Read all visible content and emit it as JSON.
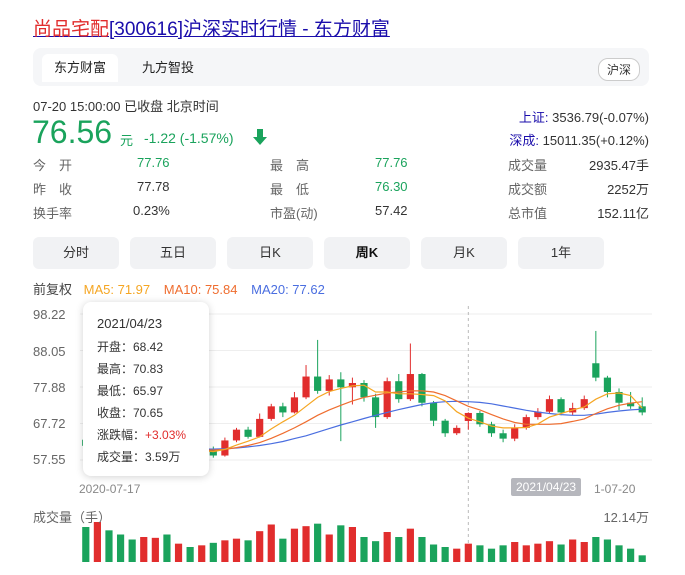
{
  "header": {
    "title_highlight": "尚品宅配",
    "title_rest": "[300616]沪深实时行情 - 东方财富"
  },
  "tabs": [
    {
      "label": "东方财富",
      "active": true
    },
    {
      "label": "九方智投",
      "active": false
    }
  ],
  "market_badge": "沪深",
  "quote": {
    "time_status": "07-20 15:00:00  已收盘  北京时间",
    "price": "76.56",
    "unit": "元",
    "change": "-1.22 (-1.57%)",
    "direction": "down"
  },
  "indices": [
    {
      "name": "上证:",
      "value": "3536.79(-0.07%)"
    },
    {
      "name": "深成:",
      "value": "15011.35(+0.12%)"
    }
  ],
  "stats": {
    "open": {
      "label": "今　开",
      "value": "77.76"
    },
    "high": {
      "label": "最　高",
      "value": "77.76"
    },
    "volume": {
      "label": "成交量",
      "value": "2935.47手"
    },
    "prev_close": {
      "label": "昨　收",
      "value": "77.78"
    },
    "low": {
      "label": "最　低",
      "value": "76.30"
    },
    "amount": {
      "label": "成交额",
      "value": "2252万"
    },
    "turnover": {
      "label": "换手率",
      "value": "0.23%"
    },
    "pe": {
      "label": "市盈(动)",
      "value": "57.42"
    },
    "mcap": {
      "label": "总市值",
      "value": "152.11亿"
    }
  },
  "periods": [
    {
      "label": "分时",
      "active": false
    },
    {
      "label": "五日",
      "active": false
    },
    {
      "label": "日K",
      "active": false
    },
    {
      "label": "周K",
      "active": true
    },
    {
      "label": "月K",
      "active": false
    },
    {
      "label": "1年",
      "active": false
    }
  ],
  "ma_legend": {
    "adj": "前复权",
    "ma5": "MA5: 71.97",
    "ma10": "MA10: 75.84",
    "ma20": "MA20: 77.62"
  },
  "colors": {
    "up": "#e12d2d",
    "down": "#1aa35c",
    "ma5": "#f5a623",
    "ma10": "#ef6d2f",
    "ma20": "#4a6ee0"
  },
  "y_axis_labels": [
    "98.22",
    "88.05",
    "77.88",
    "67.72",
    "57.55"
  ],
  "x_axis": {
    "start": "2020-07-17",
    "hover": "2021/04/23",
    "end_partial": "1-07-20"
  },
  "tooltip": {
    "date": "2021/04/23",
    "open": "开盘：68.42",
    "high": "最高：70.83",
    "low": "最低：65.97",
    "close": "收盘：70.65",
    "change_label": "涨跌幅：",
    "change_value": "+3.03%",
    "volume": "成交量：3.59万"
  },
  "volume_panel": {
    "label": "成交量（手）",
    "max": "12.14万"
  },
  "chart_data": {
    "type": "candlestick",
    "ylim": [
      57.55,
      98.22
    ],
    "candles": [
      {
        "o": 63.2,
        "c": 61.5,
        "h": 64.0,
        "l": 60.8
      },
      {
        "o": 61.6,
        "c": 62.8,
        "h": 63.5,
        "l": 60.9
      },
      {
        "o": 62.8,
        "c": 61.0,
        "h": 63.2,
        "l": 59.8
      },
      {
        "o": 61.0,
        "c": 60.2,
        "h": 61.8,
        "l": 59.2
      },
      {
        "o": 60.2,
        "c": 58.8,
        "h": 61.2,
        "l": 58.0
      },
      {
        "o": 58.8,
        "c": 59.9,
        "h": 60.5,
        "l": 58.0
      },
      {
        "o": 59.9,
        "c": 61.3,
        "h": 62.5,
        "l": 59.4
      },
      {
        "o": 61.3,
        "c": 59.8,
        "h": 62.0,
        "l": 59.0
      },
      {
        "o": 59.8,
        "c": 60.8,
        "h": 61.8,
        "l": 59.0
      },
      {
        "o": 60.8,
        "c": 59.4,
        "h": 61.2,
        "l": 58.8
      },
      {
        "o": 59.4,
        "c": 60.6,
        "h": 61.2,
        "l": 58.6
      },
      {
        "o": 60.6,
        "c": 58.8,
        "h": 61.3,
        "l": 58.2
      },
      {
        "o": 58.8,
        "c": 63.0,
        "h": 63.8,
        "l": 58.5
      },
      {
        "o": 63.0,
        "c": 66.0,
        "h": 66.5,
        "l": 62.5
      },
      {
        "o": 66.0,
        "c": 64.0,
        "h": 66.8,
        "l": 63.5
      },
      {
        "o": 64.0,
        "c": 69.0,
        "h": 70.5,
        "l": 63.8
      },
      {
        "o": 69.0,
        "c": 72.5,
        "h": 73.2,
        "l": 68.5
      },
      {
        "o": 72.5,
        "c": 70.8,
        "h": 73.5,
        "l": 69.5
      },
      {
        "o": 70.8,
        "c": 75.0,
        "h": 76.5,
        "l": 70.5
      },
      {
        "o": 75.0,
        "c": 80.8,
        "h": 84.0,
        "l": 74.5
      },
      {
        "o": 80.8,
        "c": 76.8,
        "h": 91.0,
        "l": 76.0
      },
      {
        "o": 76.8,
        "c": 80.0,
        "h": 81.2,
        "l": 75.5
      },
      {
        "o": 80.0,
        "c": 77.8,
        "h": 82.0,
        "l": 62.8
      },
      {
        "o": 77.8,
        "c": 79.0,
        "h": 80.5,
        "l": 73.0
      },
      {
        "o": 79.0,
        "c": 75.0,
        "h": 79.8,
        "l": 73.8
      },
      {
        "o": 75.0,
        "c": 69.5,
        "h": 76.0,
        "l": 66.5
      },
      {
        "o": 69.5,
        "c": 79.5,
        "h": 80.5,
        "l": 69.0
      },
      {
        "o": 79.5,
        "c": 74.5,
        "h": 81.5,
        "l": 73.5
      },
      {
        "o": 74.5,
        "c": 81.5,
        "h": 90.0,
        "l": 74.0
      },
      {
        "o": 81.5,
        "c": 73.5,
        "h": 81.8,
        "l": 72.5
      },
      {
        "o": 73.5,
        "c": 68.5,
        "h": 74.0,
        "l": 67.0
      },
      {
        "o": 68.5,
        "c": 65.0,
        "h": 69.0,
        "l": 64.0
      },
      {
        "o": 65.0,
        "c": 66.5,
        "h": 67.2,
        "l": 64.5
      },
      {
        "o": 68.42,
        "c": 70.65,
        "h": 70.83,
        "l": 65.97
      },
      {
        "o": 70.65,
        "c": 67.5,
        "h": 71.2,
        "l": 66.8
      },
      {
        "o": 67.5,
        "c": 65.0,
        "h": 68.2,
        "l": 64.0
      },
      {
        "o": 65.0,
        "c": 63.5,
        "h": 66.0,
        "l": 62.5
      },
      {
        "o": 63.5,
        "c": 66.5,
        "h": 67.5,
        "l": 62.8
      },
      {
        "o": 66.5,
        "c": 69.5,
        "h": 70.2,
        "l": 66.0
      },
      {
        "o": 69.5,
        "c": 71.0,
        "h": 72.0,
        "l": 68.8
      },
      {
        "o": 71.0,
        "c": 74.5,
        "h": 75.5,
        "l": 70.5
      },
      {
        "o": 74.5,
        "c": 70.8,
        "h": 75.0,
        "l": 70.0
      },
      {
        "o": 70.8,
        "c": 72.0,
        "h": 73.5,
        "l": 70.0
      },
      {
        "o": 72.0,
        "c": 74.5,
        "h": 75.5,
        "l": 71.5
      },
      {
        "o": 84.5,
        "c": 80.5,
        "h": 93.5,
        "l": 79.5
      },
      {
        "o": 80.5,
        "c": 76.5,
        "h": 81.0,
        "l": 75.0
      },
      {
        "o": 76.5,
        "c": 73.5,
        "h": 77.5,
        "l": 71.5
      },
      {
        "o": 73.5,
        "c": 72.5,
        "h": 76.5,
        "l": 71.8
      },
      {
        "o": 72.5,
        "c": 70.8,
        "h": 75.0,
        "l": 70.0
      }
    ],
    "ma5": [
      62.0,
      61.8,
      61.6,
      61.2,
      60.8,
      60.5,
      60.2,
      60.0,
      59.9,
      60.1,
      60.2,
      59.9,
      60.5,
      61.7,
      62.8,
      64.0,
      66.2,
      68.2,
      70.0,
      72.5,
      75.0,
      76.6,
      77.5,
      78.2,
      78.4,
      76.5,
      76.5,
      76.0,
      76.0,
      75.8,
      75.5,
      74.0,
      71.0,
      69.2,
      68.2,
      67.0,
      66.5,
      66.5,
      66.6,
      67.6,
      69.5,
      70.5,
      71.5,
      72.3,
      74.5,
      76.0,
      76.2,
      75.5,
      72.0
    ],
    "ma10": [
      62.5,
      62.3,
      62.1,
      61.9,
      61.6,
      61.3,
      61.0,
      60.7,
      60.5,
      60.4,
      60.3,
      60.3,
      60.5,
      61.0,
      61.6,
      62.4,
      63.6,
      65.0,
      66.5,
      68.2,
      70.0,
      71.5,
      72.8,
      74.0,
      75.0,
      75.6,
      76.2,
      76.5,
      76.8,
      76.8,
      76.5,
      75.5,
      74.0,
      72.5,
      71.5,
      70.2,
      69.0,
      68.0,
      67.5,
      67.5,
      67.5,
      67.7,
      68.3,
      69.0,
      70.5,
      71.8,
      72.8,
      73.4,
      73.8
    ],
    "ma20": [
      61.8,
      61.7,
      61.6,
      61.4,
      61.2,
      61.0,
      60.8,
      60.7,
      60.6,
      60.6,
      60.6,
      60.6,
      60.7,
      60.9,
      61.2,
      61.6,
      62.1,
      62.7,
      63.5,
      64.3,
      65.3,
      66.3,
      67.3,
      68.2,
      69.1,
      70.0,
      70.8,
      71.6,
      72.3,
      73.0,
      73.5,
      73.8,
      73.9,
      73.8,
      73.6,
      73.2,
      72.6,
      72.0,
      71.4,
      70.9,
      70.5,
      70.2,
      70.0,
      70.0,
      70.3,
      70.8,
      71.2,
      71.5,
      71.7
    ],
    "volume": [
      42,
      48,
      38,
      33,
      27,
      30,
      29,
      33,
      22,
      18,
      20,
      23,
      26,
      28,
      26,
      37,
      45,
      28,
      40,
      43,
      46,
      33,
      44,
      42,
      30,
      25,
      36,
      30,
      40,
      30,
      21,
      18,
      16,
      22,
      20,
      16,
      20,
      24,
      20,
      22,
      25,
      21,
      27,
      24,
      30,
      27,
      20,
      16,
      8
    ]
  }
}
